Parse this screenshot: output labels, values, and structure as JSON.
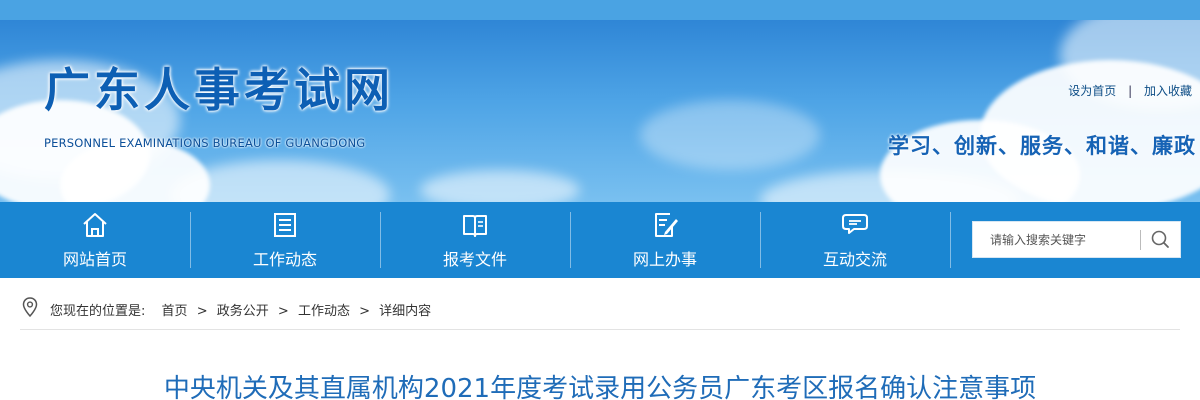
{
  "site": {
    "name_cn": "广东人事考试网",
    "name_en": "PERSONNEL EXAMINATIONS BUREAU OF GUANGDONG",
    "slogan": "学习、创新、服务、和谐、廉政"
  },
  "toplinks": {
    "set_home": "设为首页",
    "separator": "|",
    "add_favorite": "加入收藏"
  },
  "nav": {
    "items": [
      {
        "label": "网站首页",
        "icon": "home-icon"
      },
      {
        "label": "工作动态",
        "icon": "news-list-icon"
      },
      {
        "label": "报考文件",
        "icon": "book-icon"
      },
      {
        "label": "网上办事",
        "icon": "edit-document-icon"
      },
      {
        "label": "互动交流",
        "icon": "chat-bubbles-icon"
      }
    ]
  },
  "search": {
    "placeholder": "请输入搜索关键字",
    "icon": "search-icon"
  },
  "breadcrumb": {
    "lead": "您现在的位置是:",
    "items": [
      "首页",
      "政务公开",
      "工作动态",
      "详细内容"
    ],
    "separator": ">"
  },
  "article": {
    "title": "中央机关及其直属机构2021年度考试录用公务员广东考区报名确认注意事项"
  },
  "colors": {
    "top_strip": "#4aa3e3",
    "nav_bg": "#1a86d2",
    "logo_text": "#0d5fb4",
    "slogan": "#1663b5",
    "title": "#1f6cb8"
  }
}
